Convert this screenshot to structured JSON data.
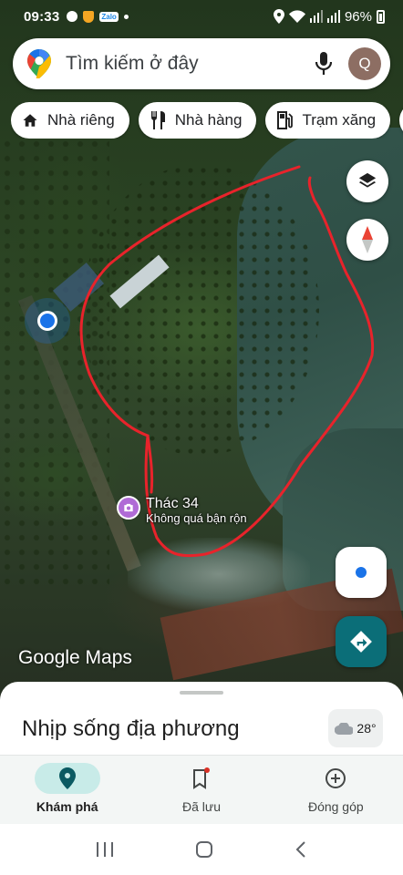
{
  "status_bar": {
    "time": "09:33",
    "notification_icons": [
      "messenger-icon",
      "shield-icon",
      "zalo-icon",
      "dot-icon"
    ],
    "zalo_label": "Zalo",
    "battery": "96%"
  },
  "search": {
    "placeholder": "Tìm kiếm ở đây",
    "avatar_letter": "Q"
  },
  "chips": [
    {
      "icon": "home-icon",
      "label": "Nhà riêng"
    },
    {
      "icon": "restaurant-icon",
      "label": "Nhà hàng"
    },
    {
      "icon": "gas-station-icon",
      "label": "Trạm xăng"
    }
  ],
  "map": {
    "poi": {
      "name": "Thác 34",
      "status": "Không quá bận rộn",
      "icon": "camera-icon",
      "color": "#b06bd6"
    },
    "attribution": "Google Maps",
    "sketch_color": "#e8232b"
  },
  "sheet": {
    "title": "Nhịp sống địa phương",
    "temperature": "28°",
    "weather_icon": "cloud-icon"
  },
  "bottom_nav": [
    {
      "icon": "explore-pin-icon",
      "label": "Khám phá",
      "active": true
    },
    {
      "icon": "bookmark-icon",
      "label": "Đã lưu",
      "active": false
    },
    {
      "icon": "add-circle-icon",
      "label": "Đóng góp",
      "active": false
    }
  ],
  "colors": {
    "accent_teal": "#0b6e78",
    "active_pill": "#c8ebe8",
    "location_blue": "#1a73e8"
  }
}
